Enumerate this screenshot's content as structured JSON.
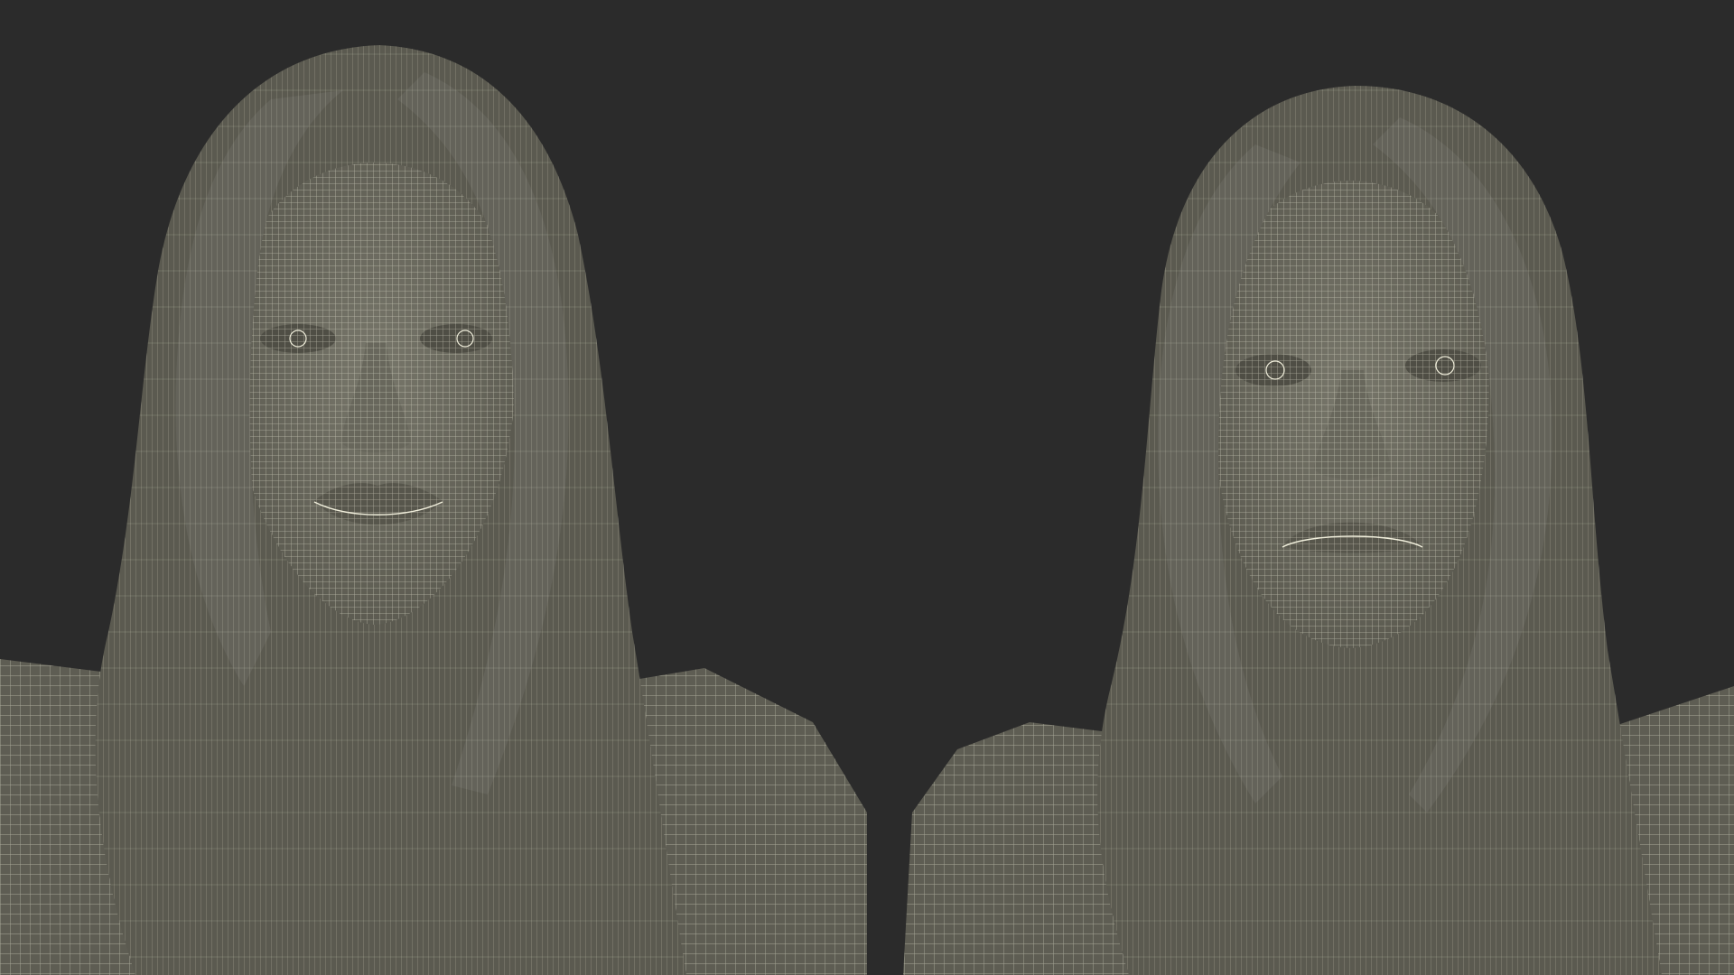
{
  "scene": {
    "description_free": true,
    "background_color": "#2b2b2b",
    "mesh_fill_color": "#6f6e63",
    "mesh_shade_color": "#56564c",
    "hair_color": "#5f5e54",
    "wire_color": "#e8e6d2",
    "figures": [
      {
        "id": "left",
        "expression": "smile"
      },
      {
        "id": "right",
        "expression": "frown"
      }
    ]
  }
}
